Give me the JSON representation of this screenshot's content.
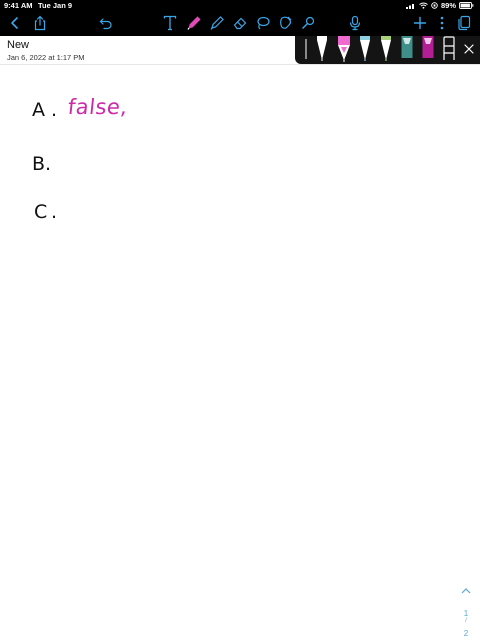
{
  "status_bar": {
    "time": "9:41 AM",
    "date": "Tue Jan 9",
    "battery_percent": "89%"
  },
  "toolbar": {
    "left_icons": [
      "back-chevron-icon",
      "share-icon",
      "undo-icon"
    ],
    "center_tools": [
      "text-tool-icon",
      "pen-tool-icon",
      "highlighter-tool-icon",
      "eraser-tool-icon",
      "lasso-tool-icon",
      "elements-tool-icon",
      "shapes-tool-icon"
    ],
    "right_icons": [
      "microphone-icon",
      "add-icon",
      "more-icon",
      "pages-icon"
    ],
    "accent_color": "#3aa6e8",
    "active_tool_color": "#e04bb8"
  },
  "document": {
    "title": "New",
    "date": "Jan 6, 2022 at 1:17 PM"
  },
  "pen_tray": {
    "pens": [
      {
        "color": "#8a8a8a"
      },
      {
        "color": "#ffffff"
      },
      {
        "color": "#f06bd0"
      },
      {
        "color": "#8fd0e0"
      },
      {
        "color": "#a8d17a"
      },
      {
        "color": "#3f8f8a"
      },
      {
        "color": "#b31e96"
      },
      {
        "color": "#ffffff"
      }
    ],
    "close_icon": "close-icon"
  },
  "notes": {
    "line_a_letter": "A",
    "line_a_dot": ".",
    "line_a_answer": "false,",
    "line_a_answer_color": "#cc2aa6",
    "line_b_letter": "B.",
    "line_c_letter": "C",
    "line_c_dot": "."
  },
  "page_nav": {
    "current": "1",
    "separator": "/",
    "total": "2"
  }
}
